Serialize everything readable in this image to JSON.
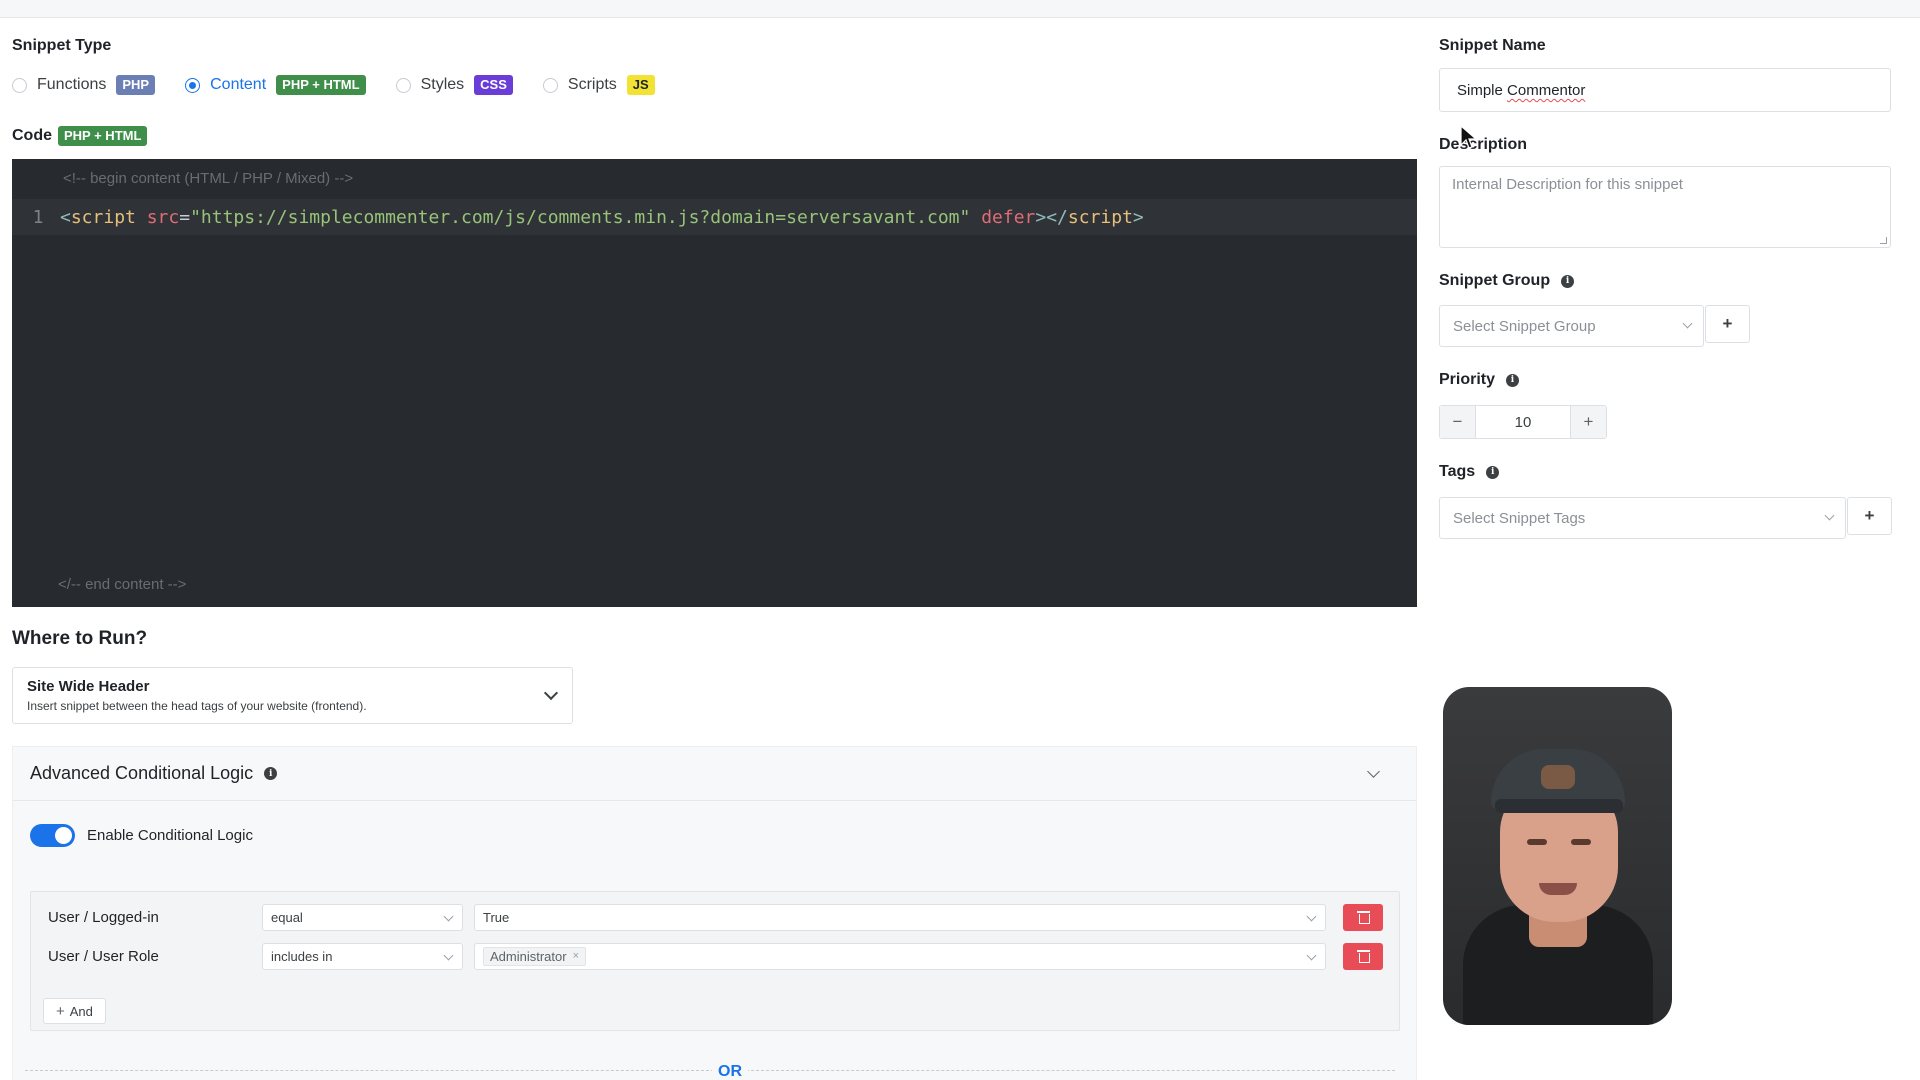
{
  "snippet_type": {
    "label": "Snippet Type",
    "options": [
      {
        "label": "Functions",
        "badge": "PHP",
        "badge_color": "#6b7fb5",
        "checked": false
      },
      {
        "label": "Content",
        "badge": "PHP + HTML",
        "badge_color": "#3f8f4b",
        "checked": true
      },
      {
        "label": "Styles",
        "badge": "CSS",
        "badge_color": "#6a3dd6",
        "checked": false
      },
      {
        "label": "Scripts",
        "badge": "JS",
        "badge_color": "#f2e233",
        "checked": false
      }
    ]
  },
  "code": {
    "label": "Code",
    "badge": "PHP + HTML",
    "top_comment": "<!-- begin content (HTML / PHP / Mixed) -->",
    "bottom_comment": "</-- end content -->",
    "line_number": "1",
    "tokens": {
      "open": "<",
      "tag": "script",
      "attr1": "src",
      "eq": "=",
      "src_value": "\"https://simplecommenter.com/js/comments.min.js?domain=serversavant.com\"",
      "attr2": "defer",
      "close_open": "></",
      "close_tag": "script",
      "close": ">"
    }
  },
  "where_to_run": {
    "title": "Where to Run?",
    "selected_title": "Site Wide Header",
    "selected_desc": "Insert snippet between the head tags of your website (frontend)."
  },
  "advanced": {
    "title": "Advanced Conditional Logic",
    "toggle_label": "Enable Conditional Logic",
    "toggle_on": true,
    "rules": [
      {
        "field": "User / Logged-in",
        "operator": "equal",
        "value": "True"
      },
      {
        "field": "User / User Role",
        "operator": "includes in",
        "chip": "Administrator"
      }
    ],
    "and_label": "And",
    "or_label": "OR"
  },
  "sidebar": {
    "name_label": "Snippet Name",
    "name_value_first": "Simple",
    "name_value_second": "Commentor",
    "desc_label": "Description",
    "desc_placeholder": "Internal Description for this snippet",
    "group_label": "Snippet Group",
    "group_placeholder": "Select Snippet Group",
    "priority_label": "Priority",
    "priority_value": "10",
    "tags_label": "Tags",
    "tags_placeholder": "Select Snippet Tags",
    "plus": "+",
    "minus": "−"
  },
  "icons": {
    "info": "i",
    "chip_close": "×"
  },
  "colors": {
    "accent": "#1a73e8",
    "danger": "#e84d57",
    "editor_bg": "#272a2f"
  }
}
